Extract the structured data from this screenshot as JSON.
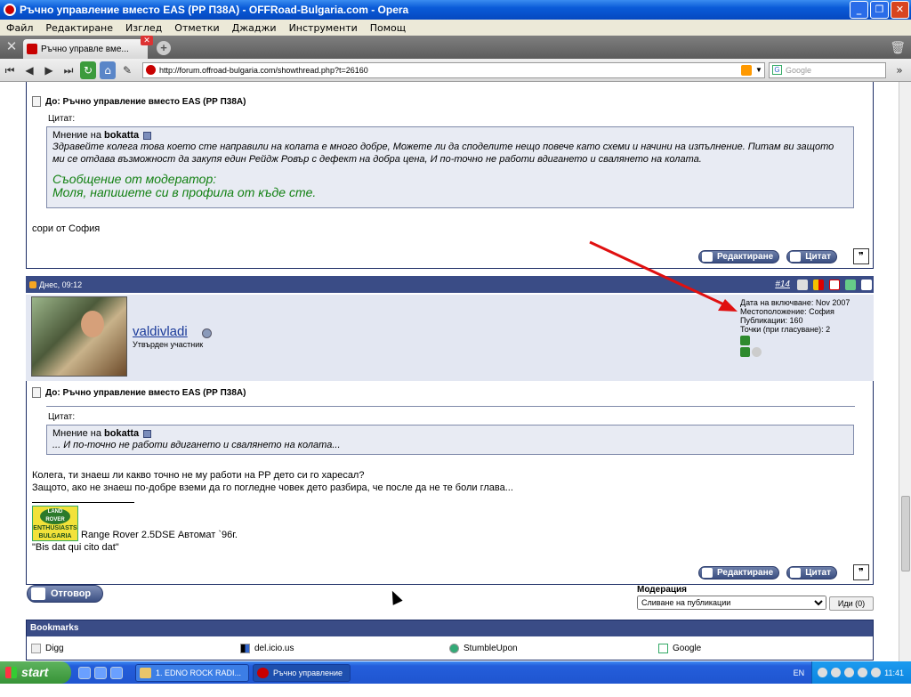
{
  "window": {
    "title": "Ръчно управление вместо EAS (РР П38А) - OFFRoad-Bulgaria.com - Opera",
    "buttons": [
      "_",
      "❐",
      "✕"
    ]
  },
  "menu": [
    "Файл",
    "Редактиране",
    "Изглед",
    "Отметки",
    "Джаджи",
    "Инструменти",
    "Помощ"
  ],
  "tab": {
    "label": "Ръчно управле вме...",
    "close": "✕"
  },
  "address": {
    "url": "http://forum.offroad-bulgaria.com/showthread.php?t=26160"
  },
  "search": {
    "placeholder": "Google"
  },
  "post1": {
    "title": "До: Ръчно управление вместо EAS (РР П38А)",
    "quote_label": "Цитат:",
    "quote_from_prefix": "Мнение на",
    "quote_author": "bokatta",
    "quote_text": "Здравейте колега това което сте направили на колата е много добре, Можете ли да споделите нещо повече като схеми и начини на изпълнение. Питам ви защото ми се отдава възможност да закупя един Рейдж Ровър с дефект на добра цена, И по-точно не работи вдигането и свалянето на колата.",
    "moderator_heading": "Съобщение от модератор:",
    "moderator_text": "Моля, напишете си в профила от къде сте.",
    "body": "сори от София"
  },
  "buttons": {
    "edit": "Редактиране",
    "quote": "Цитат",
    "multiquote": "❞"
  },
  "post2": {
    "date": "Днес, 09:12",
    "number": "#14",
    "username": "valdivladi",
    "user_title": "Утвърден участник",
    "info": [
      "Дата на включване: Nov 2007",
      "Местоположение: София",
      "Публикации: 160",
      "Точки (при гласуване): 2"
    ],
    "title": "До: Ръчно управление вместо EAS (РР П38А)",
    "quote_label": "Цитат:",
    "quote_from_prefix": "Мнение на",
    "quote_author": "bokatta",
    "quote_text": "... И по-точно не работи вдигането и свалянето на колата...",
    "body_line1": "Колега, ти знаеш ли какво точно не му работи на РР дето си го харесал?",
    "body_line2": "Защото, ако не знаеш по-добре вземи да го погледне човек дето разбира, че после да не те боли глава...",
    "logo_top": "LAND ROVER",
    "logo_line1": "ENTHUSIASTS",
    "logo_line2": "BULGARIA",
    "sig_line1": "Range Rover 2.5DSE Автомат `96г.",
    "sig_line2": "\"Bis dat qui cito dat\""
  },
  "reply_button": "Отговор",
  "moderation": {
    "label": "Модерация",
    "selected": "Сливане на публикации",
    "go": "Иди (0)"
  },
  "bookmarks": {
    "title": "Bookmarks",
    "items": [
      "Digg",
      "del.icio.us",
      "StumbleUpon",
      "Google"
    ]
  },
  "taskbar": {
    "start": "start",
    "tasks": [
      "1. EDNO ROCK RADI...",
      "Ръчно управление в..."
    ],
    "lang": "EN",
    "clock": "11:41"
  },
  "colors": {
    "header_bg": "#3a4c86",
    "quote_bg": "#e8ebf3",
    "moderator": "#128012",
    "arrow": "#e01010"
  }
}
